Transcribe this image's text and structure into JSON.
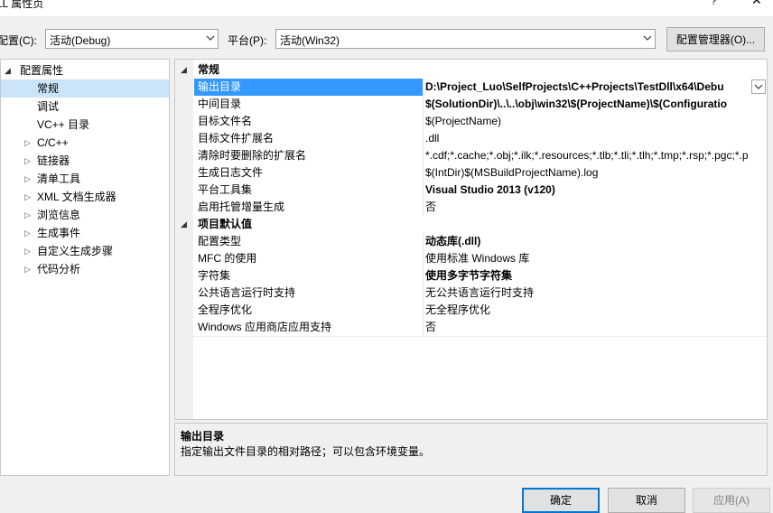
{
  "window": {
    "title": "LL 属性页",
    "help": "?",
    "close": "✕"
  },
  "toolbar": {
    "config_label": "配置(C):",
    "config_value": "活动(Debug)",
    "platform_label": "平台(P):",
    "platform_value": "活动(Win32)",
    "config_manager": "配置管理器(O)..."
  },
  "tree": {
    "root": "配置属性",
    "items": [
      {
        "label": "常规",
        "expandable": false
      },
      {
        "label": "调试",
        "expandable": false
      },
      {
        "label": "VC++ 目录",
        "expandable": false
      },
      {
        "label": "C/C++",
        "expandable": true
      },
      {
        "label": "链接器",
        "expandable": true
      },
      {
        "label": "清单工具",
        "expandable": true
      },
      {
        "label": "XML 文档生成器",
        "expandable": true
      },
      {
        "label": "浏览信息",
        "expandable": true
      },
      {
        "label": "生成事件",
        "expandable": true
      },
      {
        "label": "自定义生成步骤",
        "expandable": true
      },
      {
        "label": "代码分析",
        "expandable": true
      }
    ]
  },
  "grid": {
    "cat_general": "常规",
    "general": [
      {
        "key": "输出目录",
        "value": "D:\\Project_Luo\\SelfProjects\\C++Projects\\TestDll\\x64\\Debu",
        "bold": true
      },
      {
        "key": "中间目录",
        "value": "$(SolutionDir)\\..\\..\\obj\\win32\\$(ProjectName)\\$(Configuratio",
        "bold": true
      },
      {
        "key": "目标文件名",
        "value": "$(ProjectName)",
        "bold": false
      },
      {
        "key": "目标文件扩展名",
        "value": ".dll",
        "bold": false
      },
      {
        "key": "清除时要删除的扩展名",
        "value": "*.cdf;*.cache;*.obj;*.ilk;*.resources;*.tlb;*.tli;*.tlh;*.tmp;*.rsp;*.pgc;*.p",
        "bold": false
      },
      {
        "key": "生成日志文件",
        "value": "$(IntDir)$(MSBuildProjectName).log",
        "bold": false
      },
      {
        "key": "平台工具集",
        "value": "Visual Studio 2013 (v120)",
        "bold": true
      },
      {
        "key": "启用托管增量生成",
        "value": "否",
        "bold": false
      }
    ],
    "cat_defaults": "项目默认值",
    "defaults": [
      {
        "key": "配置类型",
        "value": "动态库(.dll)",
        "bold": true
      },
      {
        "key": "MFC 的使用",
        "value": "使用标准 Windows 库",
        "bold": false
      },
      {
        "key": "字符集",
        "value": "使用多字节字符集",
        "bold": true
      },
      {
        "key": "公共语言运行时支持",
        "value": "无公共语言运行时支持",
        "bold": false
      },
      {
        "key": "全程序优化",
        "value": "无全程序优化",
        "bold": false
      },
      {
        "key": "Windows 应用商店应用支持",
        "value": "否",
        "bold": false
      }
    ]
  },
  "description": {
    "title": "输出目录",
    "text": "指定输出文件目录的相对路径；可以包含环境变量。"
  },
  "buttons": {
    "ok": "确定",
    "cancel": "取消",
    "apply": "应用(A)"
  },
  "colors": {
    "selection": "#3399ff",
    "tree_selection": "#cce4f7",
    "ok_border": "#0078d7"
  }
}
